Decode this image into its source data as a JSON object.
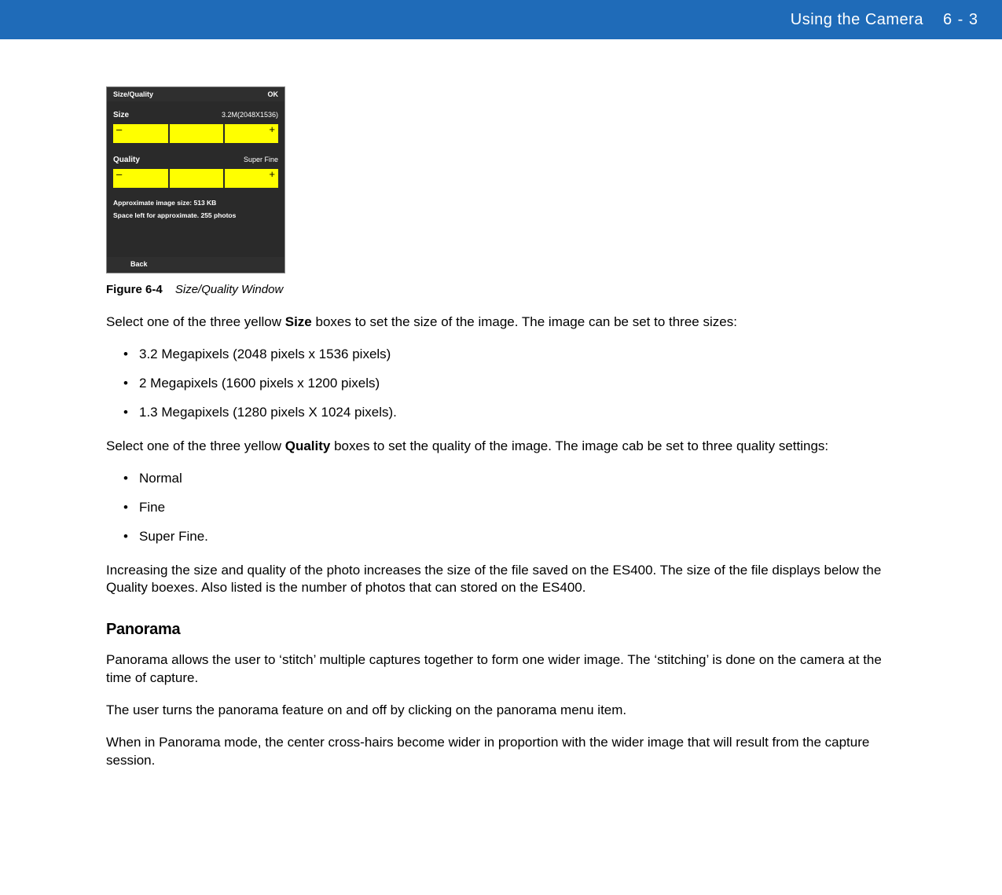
{
  "header": {
    "title": "Using the Camera",
    "page": "6 - 3"
  },
  "screenshot": {
    "title": "Size/Quality",
    "ok": "OK",
    "size_label": "Size",
    "size_value": "3.2M(2048X1536)",
    "quality_label": "Quality",
    "quality_value": "Super Fine",
    "minus": "–",
    "plus": "+",
    "info1": "Approximate image size: 513 KB",
    "info2": "Space left for approximate. 255 photos",
    "back": "Back"
  },
  "figure": {
    "label": "Figure 6-4",
    "title": "Size/Quality Window"
  },
  "para1_a": "Select one of the three yellow ",
  "para1_bold": "Size",
  "para1_b": " boxes to set the size of the image. The image can be set to three sizes:",
  "size_list": [
    "3.2 Megapixels (2048 pixels x 1536 pixels)",
    "2 Megapixels (1600 pixels x 1200 pixels)",
    "1.3 Megapixels (1280 pixels X 1024 pixels)."
  ],
  "para2_a": "Select one of the three yellow ",
  "para2_bold": "Quality",
  "para2_b": " boxes to set the quality of the image. The image cab be set to three quality settings:",
  "quality_list": [
    "Normal",
    "Fine",
    "Super Fine."
  ],
  "para3": "Increasing the size and quality of the photo increases the size of the file saved on the ES400. The size of the file displays below the Quality boexes. Also listed is the number of photos that can stored on the ES400.",
  "panorama_heading": "Panorama",
  "para4": "Panorama allows the user to ‘stitch’ multiple captures together to form one wider image. The ‘stitching’ is done on the camera at the time of capture.",
  "para5": "The user turns the panorama feature on and off by clicking on the panorama menu item.",
  "para6": "When in Panorama mode, the center cross-hairs become wider in proportion with the wider image that will result from the capture session."
}
